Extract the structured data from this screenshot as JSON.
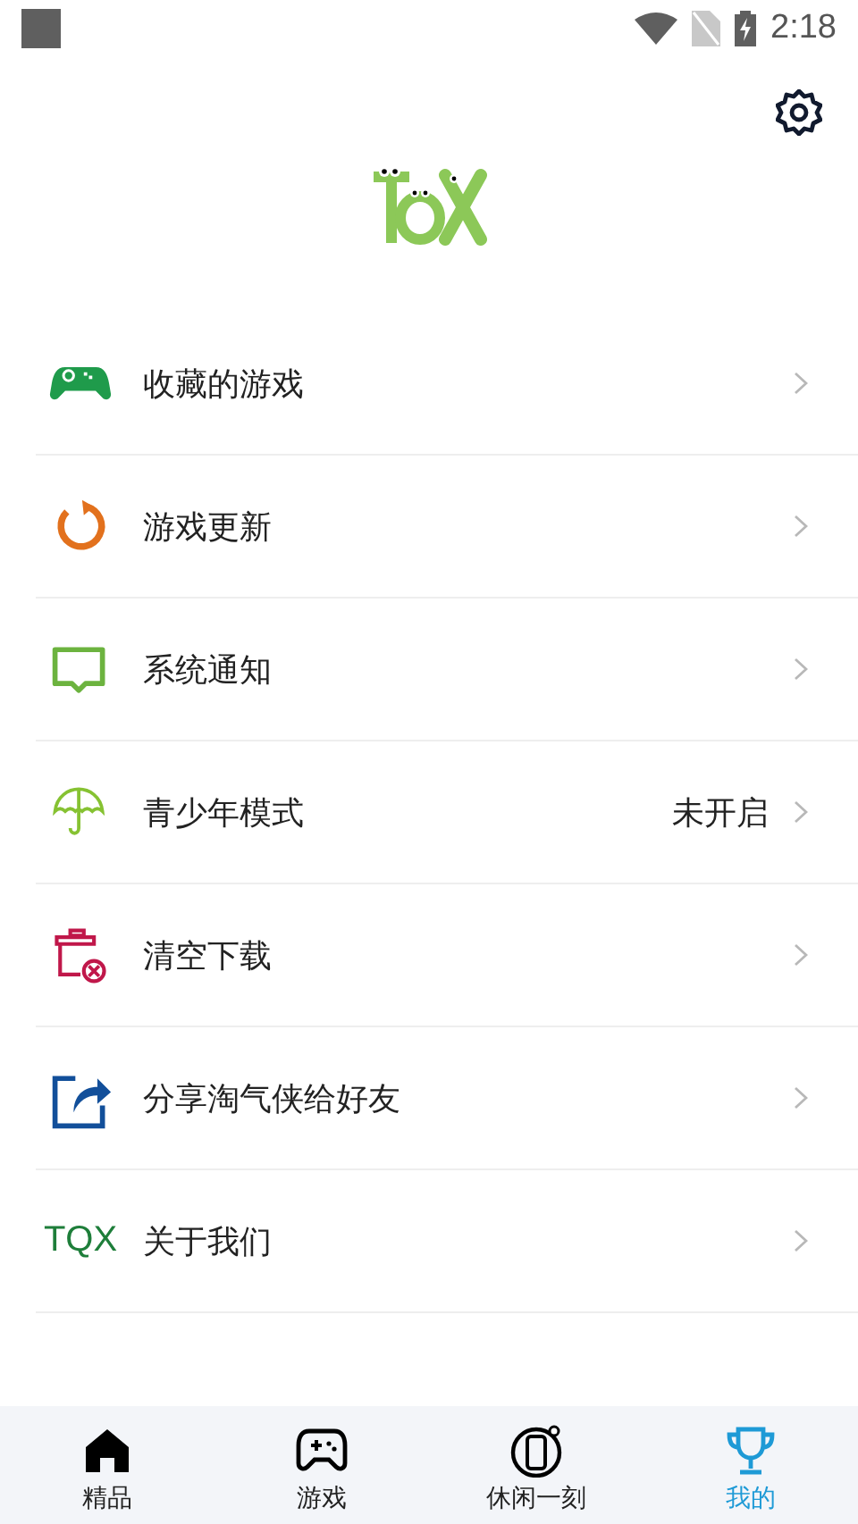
{
  "status_bar": {
    "time": "2:18"
  },
  "menu": [
    {
      "kind": "gamepad",
      "label": "收藏的游戏"
    },
    {
      "kind": "refresh",
      "label": "游戏更新"
    },
    {
      "kind": "message",
      "label": "系统通知"
    },
    {
      "kind": "umbrella",
      "label": "青少年模式",
      "value": "未开启"
    },
    {
      "kind": "trash",
      "label": "清空下载"
    },
    {
      "kind": "share",
      "label": "分享淘气侠给好友"
    },
    {
      "kind": "text",
      "icon_text": "TQX",
      "label": "关于我们"
    }
  ],
  "tabs": [
    {
      "kind": "home",
      "label": "精品",
      "selected": false
    },
    {
      "kind": "gamepad",
      "label": "游戏",
      "selected": false
    },
    {
      "kind": "phone",
      "label": "休闲一刻",
      "selected": false
    },
    {
      "kind": "trophy",
      "label": "我的",
      "selected": true
    }
  ]
}
